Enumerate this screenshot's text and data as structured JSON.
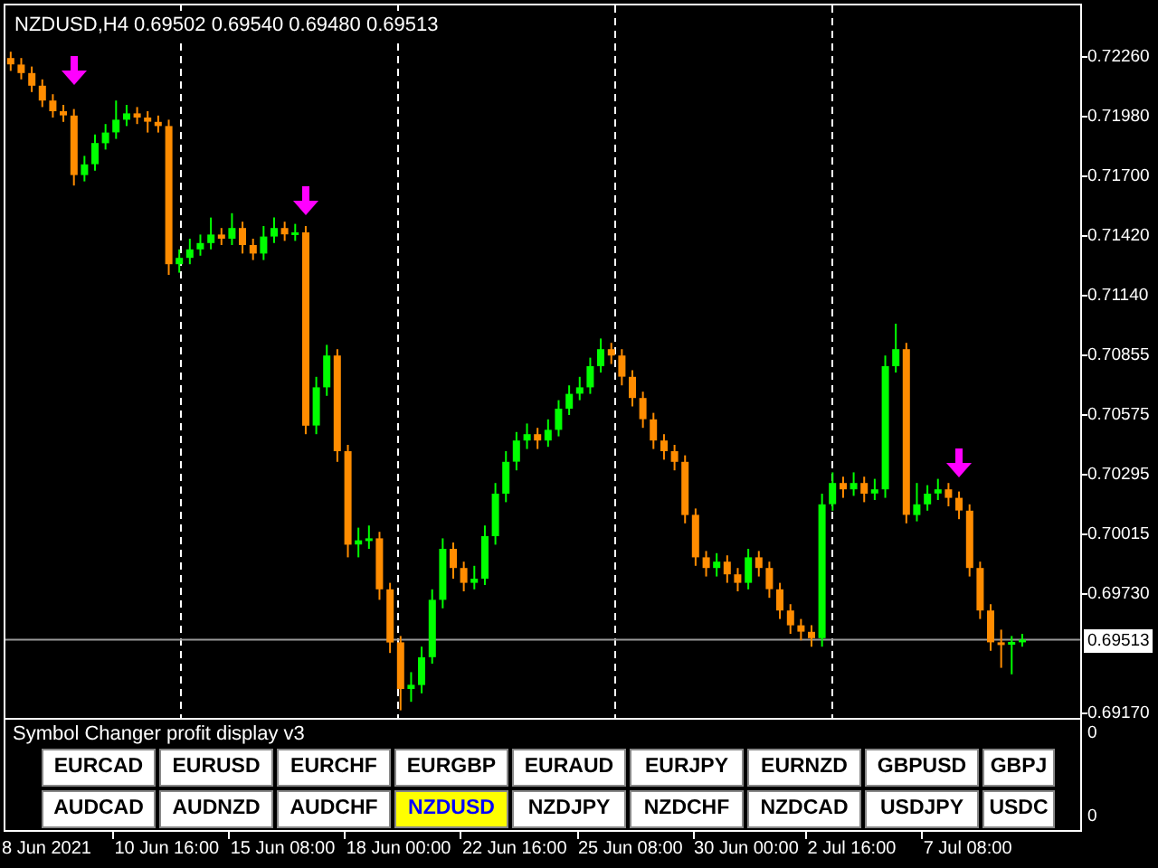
{
  "chart": {
    "symbol": "NZDUSD,H4",
    "ohlc": [
      "0.69502",
      "0.69540",
      "0.69480",
      "0.69513"
    ],
    "chart_data": {
      "categories": [
        null,
        null,
        null,
        "8 Jun 2021",
        null,
        null,
        null,
        null,
        null,
        null,
        null,
        null,
        null,
        null,
        null,
        "10 Jun 16:00",
        null,
        null,
        null,
        null,
        null,
        null,
        null,
        null,
        null,
        null,
        "15 Jun 08:00",
        null,
        null,
        null,
        null,
        null,
        null,
        null,
        null,
        null,
        null,
        "18 Jun 00:00",
        null,
        null,
        null,
        null,
        null,
        null,
        null,
        null,
        null,
        null,
        "22 Jun 16:00",
        null,
        null,
        null,
        null,
        null,
        null,
        null,
        null,
        null,
        null,
        "25 Jun 08:00",
        null,
        null,
        null,
        null,
        null,
        null,
        null,
        null,
        null,
        null,
        "30 Jun 00:00",
        null,
        null,
        null,
        null,
        null,
        null,
        null,
        null,
        null,
        "2 Jul 16:00",
        null,
        null,
        null,
        null,
        null,
        null,
        null,
        null,
        null,
        null,
        "7 Jul 08:00",
        null,
        null,
        null,
        null,
        null,
        null,
        null,
        null,
        null,
        null
      ],
      "ylim": [
        0.69136,
        0.72498
      ],
      "ohlc": [
        [
          0.7225,
          0.7228,
          0.7219,
          0.7222
        ],
        [
          0.7222,
          0.7225,
          0.7215,
          0.7218
        ],
        [
          0.7218,
          0.7221,
          0.7209,
          0.7212
        ],
        [
          0.7212,
          0.7215,
          0.7202,
          0.7205
        ],
        [
          0.7205,
          0.7208,
          0.7197,
          0.72
        ],
        [
          0.72,
          0.7203,
          0.7195,
          0.7198
        ],
        [
          0.7198,
          0.7201,
          0.7165,
          0.717
        ],
        [
          0.717,
          0.7179,
          0.7167,
          0.7175
        ],
        [
          0.7175,
          0.7189,
          0.7172,
          0.7185
        ],
        [
          0.7185,
          0.7194,
          0.7182,
          0.719
        ],
        [
          0.719,
          0.7205,
          0.7187,
          0.7196
        ],
        [
          0.7196,
          0.7203,
          0.7193,
          0.7199
        ],
        [
          0.7199,
          0.7202,
          0.7194,
          0.7197
        ],
        [
          0.7197,
          0.72,
          0.719,
          0.7195
        ],
        [
          0.7195,
          0.7198,
          0.719,
          0.7193
        ],
        [
          0.7193,
          0.7196,
          0.7123,
          0.7128
        ],
        [
          0.7128,
          0.7135,
          0.7124,
          0.7131
        ],
        [
          0.7131,
          0.714,
          0.7128,
          0.7135
        ],
        [
          0.7135,
          0.7142,
          0.7132,
          0.7138
        ],
        [
          0.7138,
          0.715,
          0.7135,
          0.7142
        ],
        [
          0.7142,
          0.7145,
          0.7137,
          0.714
        ],
        [
          0.714,
          0.7152,
          0.7137,
          0.7145
        ],
        [
          0.7145,
          0.7148,
          0.7133,
          0.7137
        ],
        [
          0.7137,
          0.714,
          0.713,
          0.7133
        ],
        [
          0.7133,
          0.7146,
          0.713,
          0.7141
        ],
        [
          0.7141,
          0.715,
          0.7138,
          0.7145
        ],
        [
          0.7145,
          0.7148,
          0.7139,
          0.7142
        ],
        [
          0.7142,
          0.7147,
          0.7139,
          0.7143
        ],
        [
          0.7143,
          0.7146,
          0.7048,
          0.7052
        ],
        [
          0.7052,
          0.7075,
          0.7048,
          0.707
        ],
        [
          0.707,
          0.709,
          0.7066,
          0.7085
        ],
        [
          0.7085,
          0.7088,
          0.7035,
          0.704
        ],
        [
          0.704,
          0.7043,
          0.699,
          0.6996
        ],
        [
          0.6996,
          0.7004,
          0.699,
          0.6998
        ],
        [
          0.6998,
          0.7005,
          0.6994,
          0.6999
        ],
        [
          0.6999,
          0.7002,
          0.697,
          0.6975
        ],
        [
          0.6975,
          0.6978,
          0.6945,
          0.695
        ],
        [
          0.695,
          0.6953,
          0.6918,
          0.6928
        ],
        [
          0.6928,
          0.6936,
          0.6922,
          0.693
        ],
        [
          0.693,
          0.6948,
          0.6926,
          0.6943
        ],
        [
          0.6943,
          0.6975,
          0.694,
          0.697
        ],
        [
          0.697,
          0.6999,
          0.6966,
          0.6994
        ],
        [
          0.6994,
          0.6997,
          0.698,
          0.6985
        ],
        [
          0.6985,
          0.6988,
          0.6974,
          0.6978
        ],
        [
          0.6978,
          0.6986,
          0.6975,
          0.698
        ],
        [
          0.698,
          0.7005,
          0.6977,
          0.7
        ],
        [
          0.7,
          0.7025,
          0.6996,
          0.702
        ],
        [
          0.702,
          0.704,
          0.7016,
          0.7035
        ],
        [
          0.7035,
          0.7049,
          0.7031,
          0.7045
        ],
        [
          0.7045,
          0.7053,
          0.7041,
          0.7048
        ],
        [
          0.7048,
          0.7051,
          0.7041,
          0.7045
        ],
        [
          0.7045,
          0.7055,
          0.7042,
          0.705
        ],
        [
          0.705,
          0.7064,
          0.7047,
          0.706
        ],
        [
          0.706,
          0.7071,
          0.7057,
          0.7067
        ],
        [
          0.7067,
          0.7075,
          0.7064,
          0.707
        ],
        [
          0.707,
          0.7084,
          0.7067,
          0.708
        ],
        [
          0.708,
          0.7093,
          0.7077,
          0.7088
        ],
        [
          0.7088,
          0.7091,
          0.7081,
          0.7085
        ],
        [
          0.7085,
          0.7088,
          0.7071,
          0.7075
        ],
        [
          0.7075,
          0.7078,
          0.7061,
          0.7065
        ],
        [
          0.7065,
          0.7068,
          0.7051,
          0.7055
        ],
        [
          0.7055,
          0.7058,
          0.7041,
          0.7045
        ],
        [
          0.7045,
          0.7048,
          0.7036,
          0.704
        ],
        [
          0.704,
          0.7043,
          0.7031,
          0.7035
        ],
        [
          0.7035,
          0.7038,
          0.7006,
          0.701
        ],
        [
          0.701,
          0.7013,
          0.6986,
          0.699
        ],
        [
          0.699,
          0.6993,
          0.6981,
          0.6985
        ],
        [
          0.6985,
          0.6992,
          0.6981,
          0.6988
        ],
        [
          0.6988,
          0.6991,
          0.6978,
          0.6982
        ],
        [
          0.6982,
          0.6985,
          0.6974,
          0.6978
        ],
        [
          0.6978,
          0.6994,
          0.6975,
          0.699
        ],
        [
          0.699,
          0.6993,
          0.6981,
          0.6985
        ],
        [
          0.6985,
          0.6988,
          0.6971,
          0.6975
        ],
        [
          0.6975,
          0.6978,
          0.6961,
          0.6965
        ],
        [
          0.6965,
          0.6968,
          0.6954,
          0.6958
        ],
        [
          0.6958,
          0.6961,
          0.6951,
          0.6955
        ],
        [
          0.6955,
          0.6958,
          0.6948,
          0.6952
        ],
        [
          0.6952,
          0.702,
          0.6948,
          0.7015
        ],
        [
          0.7015,
          0.703,
          0.7012,
          0.7025
        ],
        [
          0.7025,
          0.7028,
          0.7018,
          0.7022
        ],
        [
          0.7022,
          0.703,
          0.7019,
          0.7025
        ],
        [
          0.7025,
          0.7028,
          0.7016,
          0.702
        ],
        [
          0.702,
          0.7027,
          0.7017,
          0.7022
        ],
        [
          0.7022,
          0.7085,
          0.7018,
          0.708
        ],
        [
          0.708,
          0.71,
          0.7077,
          0.7088
        ],
        [
          0.7088,
          0.7091,
          0.7006,
          0.701
        ],
        [
          0.701,
          0.7025,
          0.7007,
          0.7015
        ],
        [
          0.7015,
          0.7024,
          0.7012,
          0.702
        ],
        [
          0.702,
          0.7027,
          0.7017,
          0.7022
        ],
        [
          0.7022,
          0.7025,
          0.7014,
          0.7018
        ],
        [
          0.7018,
          0.7021,
          0.7008,
          0.7012
        ],
        [
          0.7012,
          0.7015,
          0.6981,
          0.6985
        ],
        [
          0.6985,
          0.6988,
          0.6961,
          0.6965
        ],
        [
          0.6965,
          0.6968,
          0.6946,
          0.695
        ],
        [
          0.695,
          0.6956,
          0.6938,
          0.695
        ],
        [
          0.695,
          0.6953,
          0.6935,
          0.69502
        ],
        [
          0.69502,
          0.6954,
          0.6948,
          0.69513
        ],
        null,
        null,
        null,
        null,
        null
      ],
      "ref_lines": [
        {
          "axis": "y",
          "value": 0.69513,
          "label": "0.69513"
        }
      ],
      "yticks": [
        {
          "value": 0.7226,
          "label": "0.72260"
        },
        {
          "value": 0.7198,
          "label": "0.71980"
        },
        {
          "value": 0.717,
          "label": "0.71700"
        },
        {
          "value": 0.7142,
          "label": "0.71420"
        },
        {
          "value": 0.7114,
          "label": "0.71140"
        },
        {
          "value": 0.70855,
          "label": "0.70855"
        },
        {
          "value": 0.70575,
          "label": "0.70575"
        },
        {
          "value": 0.70295,
          "label": "0.70295"
        },
        {
          "value": 0.70015,
          "label": "0.70015"
        },
        {
          "value": 0.6973,
          "label": "0.69730"
        },
        {
          "value": 0.6917,
          "label": "0.69170"
        }
      ],
      "type": "candlestick"
    }
  },
  "indicator": {
    "title": "Symbol Changer profit display v3",
    "axis": [
      "0",
      "0"
    ],
    "buttons": [
      {
        "label": "EURCAD",
        "selected": false
      },
      {
        "label": "EURUSD",
        "selected": false
      },
      {
        "label": "EURCHF",
        "selected": false
      },
      {
        "label": "EURGBP",
        "selected": false
      },
      {
        "label": "EURAUD",
        "selected": false
      },
      {
        "label": "EURJPY",
        "selected": false
      },
      {
        "label": "EURNZD",
        "selected": false
      },
      {
        "label": "GBPUSD",
        "selected": false
      },
      {
        "label": "GBPJ",
        "selected": false
      },
      {
        "label": "AUDCAD",
        "selected": false
      },
      {
        "label": "AUDNZD",
        "selected": false
      },
      {
        "label": "AUDCHF",
        "selected": false
      },
      {
        "label": "NZDUSD",
        "selected": true
      },
      {
        "label": "NZDJPY",
        "selected": false
      },
      {
        "label": "NZDCHF",
        "selected": false
      },
      {
        "label": "NZDCAD",
        "selected": false
      },
      {
        "label": "USDJPY",
        "selected": false
      },
      {
        "label": "USDC",
        "selected": false
      }
    ]
  }
}
